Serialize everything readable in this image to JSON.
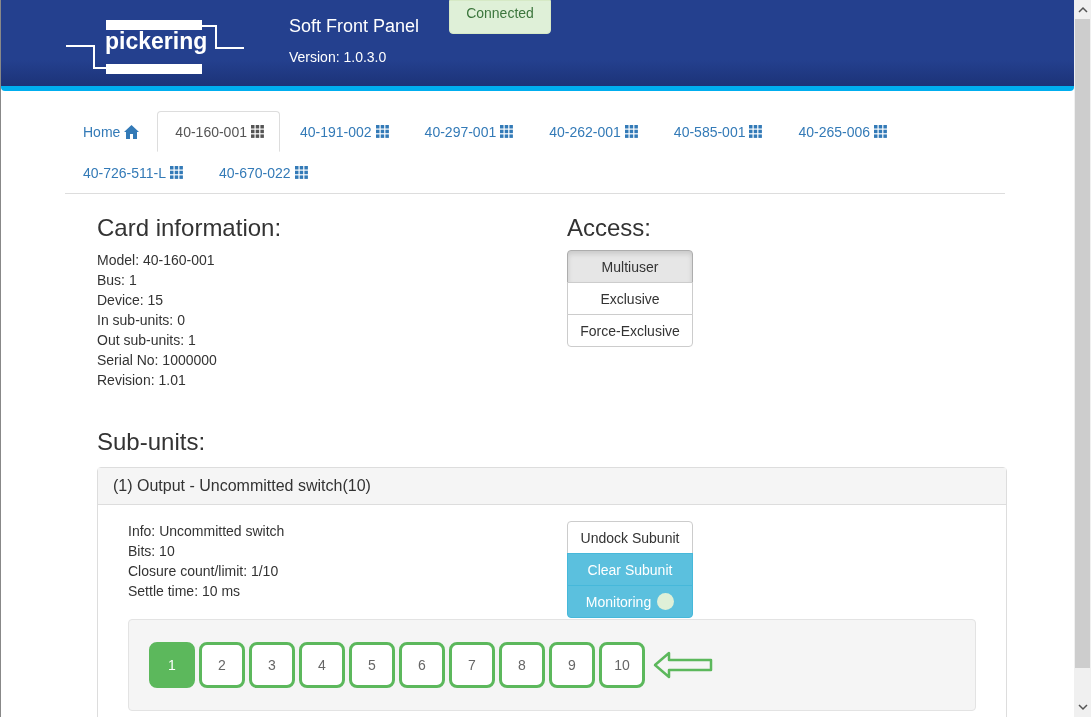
{
  "header": {
    "logo": "pickering",
    "title": "Soft Front Panel",
    "version": "Version: 1.0.3.0",
    "status": "Connected"
  },
  "tabs": [
    {
      "label": "Home",
      "kind": "home",
      "selected": false
    },
    {
      "label": "40-160-001",
      "kind": "card",
      "selected": true
    },
    {
      "label": "40-191-002",
      "kind": "card",
      "selected": false
    },
    {
      "label": "40-297-001",
      "kind": "card",
      "selected": false
    },
    {
      "label": "40-262-001",
      "kind": "card",
      "selected": false
    },
    {
      "label": "40-585-001",
      "kind": "card",
      "selected": false
    },
    {
      "label": "40-265-006",
      "kind": "card",
      "selected": false
    },
    {
      "label": "40-726-511-L",
      "kind": "card",
      "selected": false
    },
    {
      "label": "40-670-022",
      "kind": "card",
      "selected": false
    }
  ],
  "card_information": {
    "heading": "Card information:",
    "lines": [
      "Model: 40-160-001",
      "Bus: 1",
      "Device: 15",
      "In sub-units: 0",
      "Out sub-units: 1",
      "Serial No: 1000000",
      "Revision: 1.01"
    ]
  },
  "access": {
    "heading": "Access:",
    "options": [
      {
        "label": "Multiuser",
        "selected": true
      },
      {
        "label": "Exclusive",
        "selected": false
      },
      {
        "label": "Force-Exclusive",
        "selected": false
      }
    ]
  },
  "subunits": {
    "heading": "Sub-units:",
    "panels": [
      {
        "title": "(1) Output - Uncommitted switch(10)",
        "info": [
          "Info: Uncommitted switch",
          "Bits: 10",
          "Closure count/limit: 1/10",
          "Settle time: 10 ms"
        ],
        "undock": "Undock Subunit",
        "clear": "Clear Subunit",
        "monitoring": {
          "label": "Monitoring",
          "on": false
        },
        "relays": [
          {
            "label": "1",
            "closed": true
          },
          {
            "label": "2",
            "closed": false
          },
          {
            "label": "3",
            "closed": false
          },
          {
            "label": "4",
            "closed": false
          },
          {
            "label": "5",
            "closed": false
          },
          {
            "label": "6",
            "closed": false
          },
          {
            "label": "7",
            "closed": false
          },
          {
            "label": "8",
            "closed": false
          },
          {
            "label": "9",
            "closed": false
          },
          {
            "label": "10",
            "closed": false
          }
        ]
      }
    ]
  }
}
